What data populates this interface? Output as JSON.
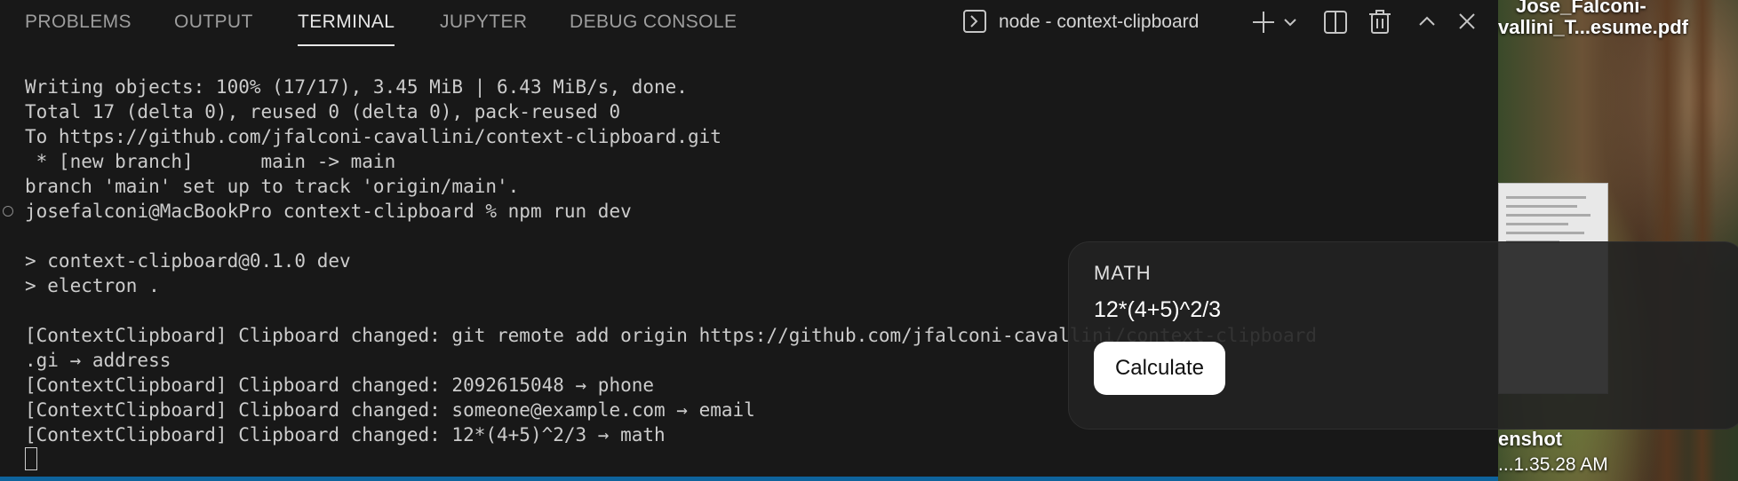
{
  "panel": {
    "tabs": [
      {
        "label": "PROBLEMS",
        "active": false
      },
      {
        "label": "OUTPUT",
        "active": false
      },
      {
        "label": "TERMINAL",
        "active": true
      },
      {
        "label": "JUPYTER",
        "active": false
      },
      {
        "label": "DEBUG CONSOLE",
        "active": false
      }
    ],
    "terminal_name": "node - context-clipboard",
    "action_icons": [
      "terminal-icon",
      "plus-icon",
      "chevron-down-icon",
      "split-icon",
      "trash-icon",
      "chevron-up-icon",
      "close-icon"
    ]
  },
  "terminal": {
    "lines": [
      "Writing objects: 100% (17/17), 3.45 MiB | 6.43 MiB/s, done.",
      "Total 17 (delta 0), reused 0 (delta 0), pack-reused 0",
      "To https://github.com/jfalconi-cavallini/context-clipboard.git",
      " * [new branch]      main -> main",
      "branch 'main' set up to track 'origin/main'.",
      "josefalconi@MacBookPro context-clipboard % npm run dev",
      "",
      "> context-clipboard@0.1.0 dev",
      "> electron .",
      "",
      "[ContextClipboard] Clipboard changed: git remote add origin https://github.com/jfalconi-cavallini/context-clipboard",
      ".gi → address",
      "[ContextClipboard] Clipboard changed: 2092615048 → phone",
      "[ContextClipboard] Clipboard changed: someone@example.com → email",
      "[ContextClipboard] Clipboard changed: 12*(4+5)^2/3 → math"
    ]
  },
  "popup": {
    "category": "MATH",
    "expression": "12*(4+5)^2/3",
    "button_label": "Calculate"
  },
  "desktop": {
    "pdf_label_line1": "Jose_Falconi-",
    "pdf_label_line2": "vallini_T...esume.pdf",
    "screenshot_label_line1": "enshot",
    "screenshot_label_line2": "...1.35.28 AM"
  },
  "colors": {
    "panel_bg": "#181818",
    "status_blue": "#0e639c",
    "popup_bg": "#222222"
  }
}
